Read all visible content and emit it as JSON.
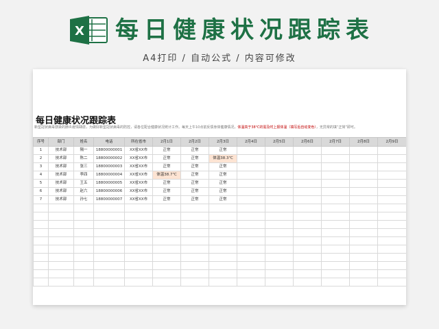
{
  "header": {
    "title": "每日健康状况跟踪表",
    "subtitle": "A4打印 / 自动公式 / 内容可修改"
  },
  "sheet": {
    "title": "每日健康状况跟踪表",
    "note_prefix": "新型冠状病毒感染的肺炎疫情肆虐，为做好新型冠状病毒的防控，请各位配合健康状况统计工作。每天上午10点前反馈身体健康情况，",
    "note_warn": "体温高于38℃的需及时上报体温（填写后自动变色）",
    "note_suffix": "，无异常的填“正常”即可。"
  },
  "colors": {
    "brand_green": "#1e7145",
    "alert_bg": "#fde4d3",
    "alert_text": "#c0392b",
    "header_bg": "#d9d9d9"
  },
  "table": {
    "headers": [
      "序号",
      "部门",
      "姓名",
      "电话",
      "所在省市",
      "2月1日",
      "2月2日",
      "2月3日",
      "2月4日",
      "2月5日",
      "2月6日",
      "2月7日",
      "2月8日",
      "2月9日"
    ],
    "rows": [
      [
        "1",
        "技术部",
        "隔一",
        "18800000001",
        "XX省XX市",
        "正常",
        "正常",
        "正常",
        "",
        "",
        "",
        "",
        "",
        ""
      ],
      [
        "2",
        "技术部",
        "陈二",
        "18800000002",
        "XX省XX市",
        "正常",
        "正常",
        "体温38.3℃",
        "",
        "",
        "",
        "",
        "",
        ""
      ],
      [
        "3",
        "技术部",
        "张三",
        "18800000003",
        "XX省XX市",
        "正常",
        "正常",
        "正常",
        "",
        "",
        "",
        "",
        "",
        ""
      ],
      [
        "4",
        "技术部",
        "李四",
        "18800000004",
        "XX省XX市",
        "体温38.7℃",
        "正常",
        "正常",
        "",
        "",
        "",
        "",
        "",
        ""
      ],
      [
        "5",
        "技术部",
        "王五",
        "18800000005",
        "XX省XX市",
        "正常",
        "正常",
        "正常",
        "",
        "",
        "",
        "",
        "",
        ""
      ],
      [
        "6",
        "技术部",
        "赵六",
        "18800000006",
        "XX省XX市",
        "正常",
        "正常",
        "正常",
        "",
        "",
        "",
        "",
        "",
        ""
      ],
      [
        "7",
        "技术部",
        "孙七",
        "18800000007",
        "XX省XX市",
        "正常",
        "正常",
        "正常",
        "",
        "",
        "",
        "",
        "",
        ""
      ]
    ],
    "alerts": [
      [
        1,
        7
      ],
      [
        3,
        5
      ]
    ],
    "empty_rows": 10
  }
}
